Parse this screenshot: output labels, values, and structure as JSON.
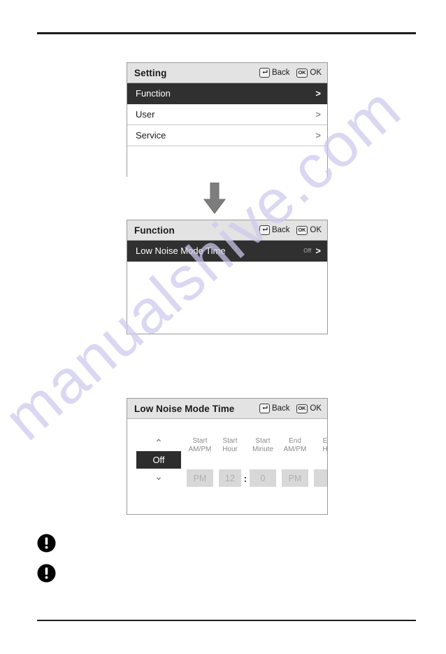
{
  "page": {
    "watermark_text": "manualshive.com",
    "watermark_color": "#cdc9ee",
    "accent_selected_bg": "#303030",
    "header_bg": "#e3e3e3",
    "rule_color": "#1c1c1c"
  },
  "header_keys": {
    "back_icon": "return-arrow-icon",
    "back_label": "Back",
    "ok_key_label": "OK",
    "ok_label": "OK"
  },
  "panels": [
    {
      "title": "Setting",
      "rows": [
        {
          "label": "Function",
          "value": "",
          "selected": true,
          "chevron": ">"
        },
        {
          "label": "User",
          "value": "",
          "selected": false,
          "chevron": ">"
        },
        {
          "label": "Service",
          "value": "",
          "selected": false,
          "chevron": ">"
        }
      ]
    },
    {
      "title": "Function",
      "rows": [
        {
          "label": "Low Noise Mode Time",
          "value": "Off",
          "selected": true,
          "chevron": ">"
        }
      ]
    },
    {
      "title": "Low Noise Mode Time",
      "onoff": {
        "up_caret": "⌃",
        "value": "Off",
        "down_caret": "⌄"
      },
      "fields": [
        {
          "head_line1": "Start",
          "head_line2": "AM/PM",
          "value": "PM",
          "width": "ampm"
        },
        {
          "head_line1": "Start",
          "head_line2": "Hour",
          "value": "12",
          "width": "hour"
        },
        {
          "head_line1": "Start",
          "head_line2": "Minute",
          "value": "0",
          "width": "min"
        },
        {
          "head_line1": "End",
          "head_line2": "AM/PM",
          "value": "PM",
          "width": "ampm"
        },
        {
          "head_line1": "E",
          "head_line2": "H",
          "value": "",
          "width": "hour"
        }
      ],
      "colon": ":"
    }
  ],
  "flow_arrow": {
    "icon": "down-arrow-icon",
    "color": "#7a7a7a"
  },
  "notes": [
    {
      "icon": "exclamation-circle-icon",
      "text": ""
    },
    {
      "icon": "exclamation-circle-icon",
      "text": ""
    }
  ]
}
